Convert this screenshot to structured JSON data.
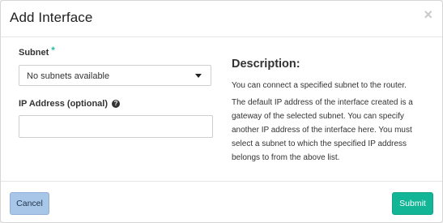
{
  "dialog": {
    "title": "Add Interface",
    "close_glyph": "×"
  },
  "form": {
    "subnet": {
      "label": "Subnet",
      "required_mark": "*",
      "selected_value": "No subnets available"
    },
    "ip_address": {
      "label": "IP Address (optional)",
      "help_glyph": "?",
      "value": "",
      "placeholder": ""
    }
  },
  "description": {
    "title": "Description:",
    "paragraphs": [
      "You can connect a specified subnet to the router.",
      "The default IP address of the interface created is a gateway of the selected subnet. You can specify another IP address of the interface here. You must select a subnet to which the specified IP address belongs to from the above list."
    ]
  },
  "footer": {
    "cancel_label": "Cancel",
    "submit_label": "Submit"
  },
  "colors": {
    "accent": "#2bbf9f",
    "submit_bg": "#12b595",
    "cancel_bg": "#a8c6e8"
  }
}
